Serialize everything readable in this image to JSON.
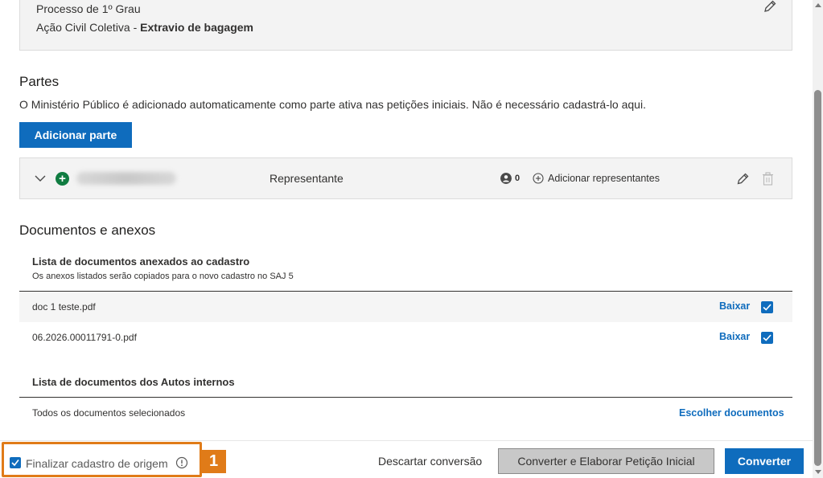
{
  "processo": {
    "line1": "Processo de 1º Grau",
    "line2_prefix": "Ação Civil Coletiva - ",
    "line2_bold": "Extravio de bagagem"
  },
  "partes": {
    "title": "Partes",
    "description": "O Ministério Público é adicionado automaticamente como parte ativa nas petições iniciais. Não é necessário cadastrá-lo aqui.",
    "add_button": "Adicionar parte",
    "rows": [
      {
        "role": "Representante",
        "representatives_count": "0",
        "add_representatives": "Adicionar representantes"
      }
    ]
  },
  "documentos": {
    "title": "Documentos e anexos",
    "anexados": {
      "title": "Lista de documentos anexados ao cadastro",
      "description": "Os anexos listados serão copiados para o novo cadastro no SAJ 5",
      "items": [
        {
          "name": "doc 1 teste.pdf",
          "action": "Baixar",
          "checked": true
        },
        {
          "name": "06.2026.00011791-0.pdf",
          "action": "Baixar",
          "checked": true
        }
      ]
    },
    "autos": {
      "title": "Lista de documentos dos Autos internos",
      "status": "Todos os documentos selecionados",
      "action": "Escolher documentos"
    }
  },
  "footer": {
    "finalizar_label": "Finalizar cadastro de origem",
    "finalizar_checked": true,
    "annotation_badge": "1",
    "descartar": "Descartar conversão",
    "converter_elaborar": "Converter e Elaborar Petição Inicial",
    "converter": "Converter"
  },
  "colors": {
    "primary": "#0f6cbd",
    "highlight": "#e07b18",
    "add_green": "#107c41"
  },
  "icons": {
    "edit": "pencil-icon",
    "expand": "chevron-down-icon",
    "add_party": "plus-circle-icon",
    "person": "person-icon",
    "add": "plus-outline-icon",
    "delete": "trash-icon",
    "info": "info-icon",
    "checkbox": "checkbox-checked-icon"
  }
}
